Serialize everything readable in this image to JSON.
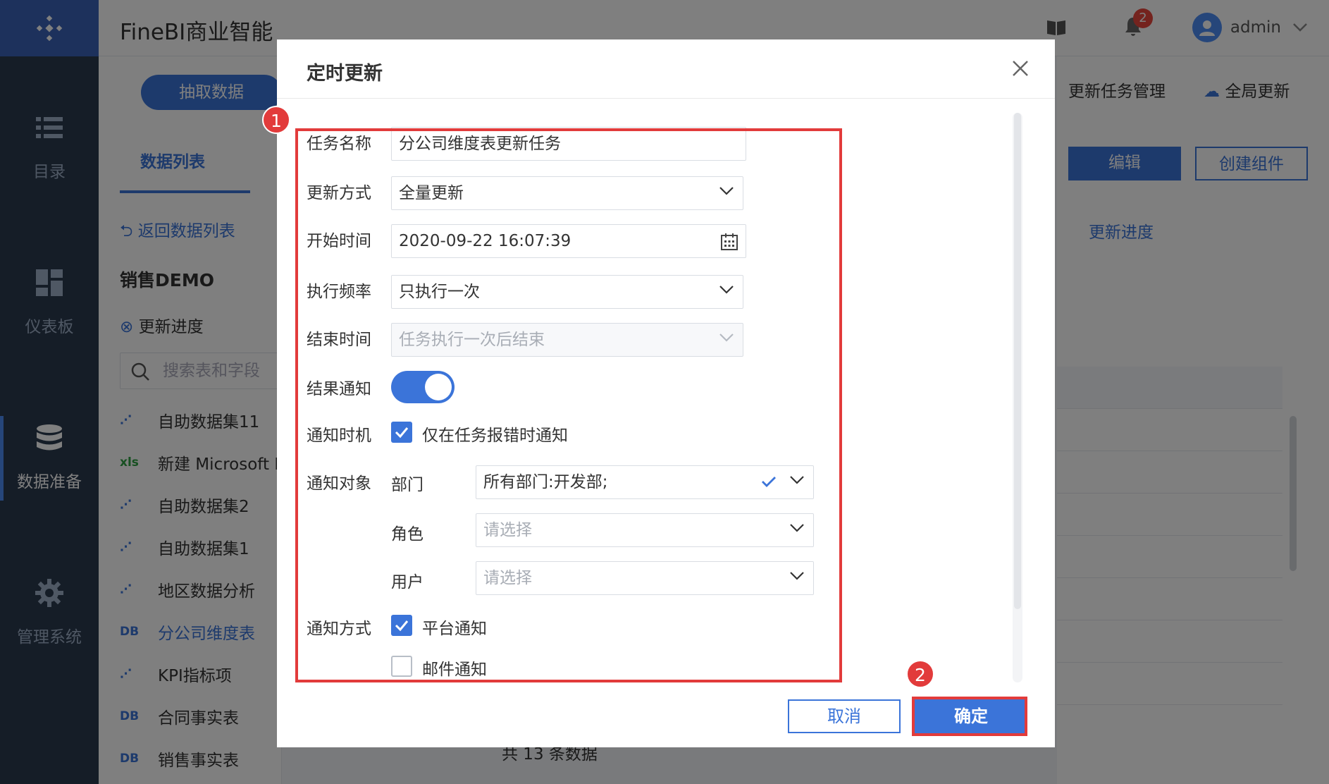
{
  "app": {
    "title": "FineBI商业智能",
    "username": "admin",
    "notification_count": "2"
  },
  "nav": {
    "items": [
      {
        "label": "目录",
        "icon": "list-icon"
      },
      {
        "label": "仪表板",
        "icon": "dashboard-icon"
      },
      {
        "label": "数据准备",
        "icon": "database-icon"
      },
      {
        "label": "管理系统",
        "icon": "gear-icon"
      }
    ]
  },
  "left_panel": {
    "extract_button": "抽取数据",
    "tab": "数据列表",
    "back_link": "返回数据列表",
    "group_title": "销售DEMO",
    "progress_link": "更新进度",
    "search_placeholder": "搜索表和字段",
    "datasets": [
      {
        "tag": "⋰",
        "label": "自助数据集11"
      },
      {
        "tag": "xls",
        "label": "新建 Microsoft E"
      },
      {
        "tag": "⋰",
        "label": "自助数据集2"
      },
      {
        "tag": "⋰",
        "label": "自助数据集1"
      },
      {
        "tag": "⋰",
        "label": "地区数据分析"
      },
      {
        "tag": "DB",
        "label": "分公司维度表"
      },
      {
        "tag": "⋰",
        "label": "KPI指标项"
      },
      {
        "tag": "DB",
        "label": "合同事实表"
      },
      {
        "tag": "DB",
        "label": "销售事实表"
      }
    ]
  },
  "right_area": {
    "task_manage": "更新任务管理",
    "global_update": "全局更新",
    "edit_button": "编辑",
    "create_component_button": "创建组件",
    "progress_tab": "更新进度"
  },
  "bottom": {
    "count_text": "共 13 条数据"
  },
  "dialog": {
    "title": "定时更新",
    "labels": {
      "task_name": "任务名称",
      "update_mode": "更新方式",
      "start_time": "开始时间",
      "frequency": "执行频率",
      "end_time": "结束时间",
      "result_notify": "结果通知",
      "notify_timing": "通知时机",
      "notify_target": "通知对象",
      "notify_method": "通知方式",
      "department": "部门",
      "role": "角色",
      "user": "用户"
    },
    "values": {
      "task_name": "分公司维度表更新任务",
      "update_mode": "全量更新",
      "start_time": "2020-09-22 16:07:39",
      "frequency": "只执行一次",
      "end_time": "任务执行一次后结束",
      "department": "所有部门:开发部;",
      "role_placeholder": "请选择",
      "user_placeholder": "请选择"
    },
    "toggle_result_notify": true,
    "checkbox_error_only": {
      "label": "仅在任务报错时通知",
      "checked": true
    },
    "checkbox_platform": {
      "label": "平台通知",
      "checked": true
    },
    "checkbox_email": {
      "label": "邮件通知",
      "checked": false
    },
    "cancel_button": "取消",
    "ok_button": "确定"
  },
  "annotations": {
    "badge_1": "1",
    "badge_2": "2"
  },
  "colors": {
    "accent": "#3b74d9",
    "marker": "#e23b3b",
    "nav_bg": "#2b3a4f"
  }
}
